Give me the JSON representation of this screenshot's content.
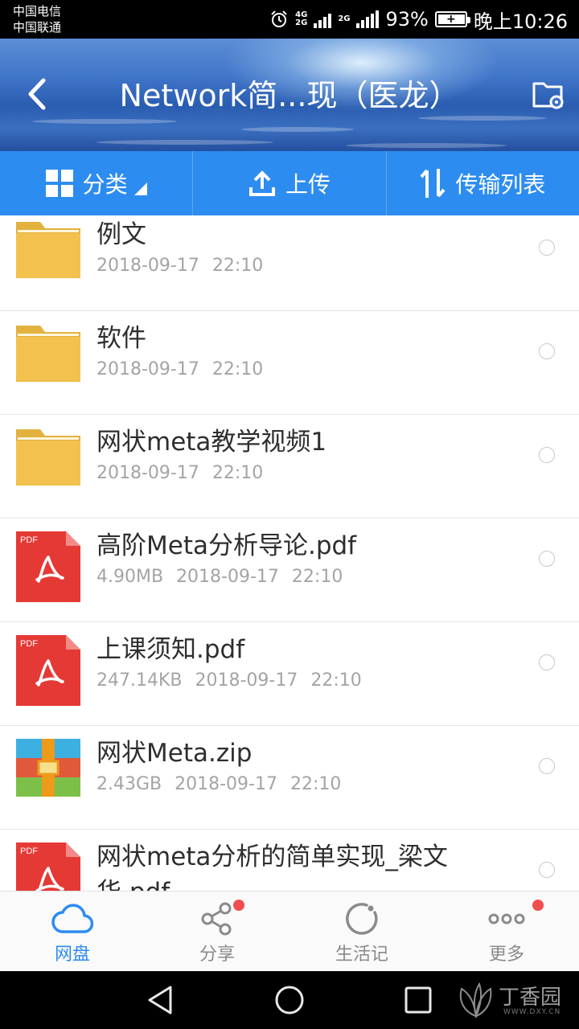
{
  "status_bar": {
    "carrier_1": "中国电信",
    "carrier_2": "中国联通",
    "net_1": "4G",
    "net_2": "2G",
    "net_3": "2G",
    "battery": "93%",
    "time": "晚上10:26"
  },
  "header": {
    "title": "Network简...现（医龙）"
  },
  "toolbar": {
    "category_label": "分类",
    "upload_label": "上传",
    "transfer_label": "传输列表"
  },
  "files": [
    {
      "type": "folder",
      "name": "例文",
      "size": "",
      "date": "2018-09-17",
      "time": "22:10"
    },
    {
      "type": "folder",
      "name": "软件",
      "size": "",
      "date": "2018-09-17",
      "time": "22:10"
    },
    {
      "type": "folder",
      "name": "网状meta教学视频1",
      "size": "",
      "date": "2018-09-17",
      "time": "22:10"
    },
    {
      "type": "pdf",
      "name": "高阶Meta分析导论.pdf",
      "size": "4.90MB",
      "date": "2018-09-17",
      "time": "22:10"
    },
    {
      "type": "pdf",
      "name": "上课须知.pdf",
      "size": "247.14KB",
      "date": "2018-09-17",
      "time": "22:10"
    },
    {
      "type": "zip",
      "name": "网状Meta.zip",
      "size": "2.43GB",
      "date": "2018-09-17",
      "time": "22:10"
    },
    {
      "type": "pdf",
      "name": "网状meta分析的简单实现_梁文华.pdf",
      "size": "",
      "date": "",
      "time": ""
    }
  ],
  "pdf_badge": "PDF",
  "bottom_nav": {
    "items": [
      {
        "label": "网盘",
        "active": true
      },
      {
        "label": "分享",
        "badge": true
      },
      {
        "label": "生活记"
      },
      {
        "label": "更多",
        "badge": true
      }
    ]
  },
  "watermark": {
    "text": "丁香园",
    "sub": "WWW.DXY.CN"
  },
  "colors": {
    "accent": "#2d8cf0",
    "folder": "#f2c14e",
    "pdf": "#e53935",
    "badge": "#f04f4f"
  }
}
